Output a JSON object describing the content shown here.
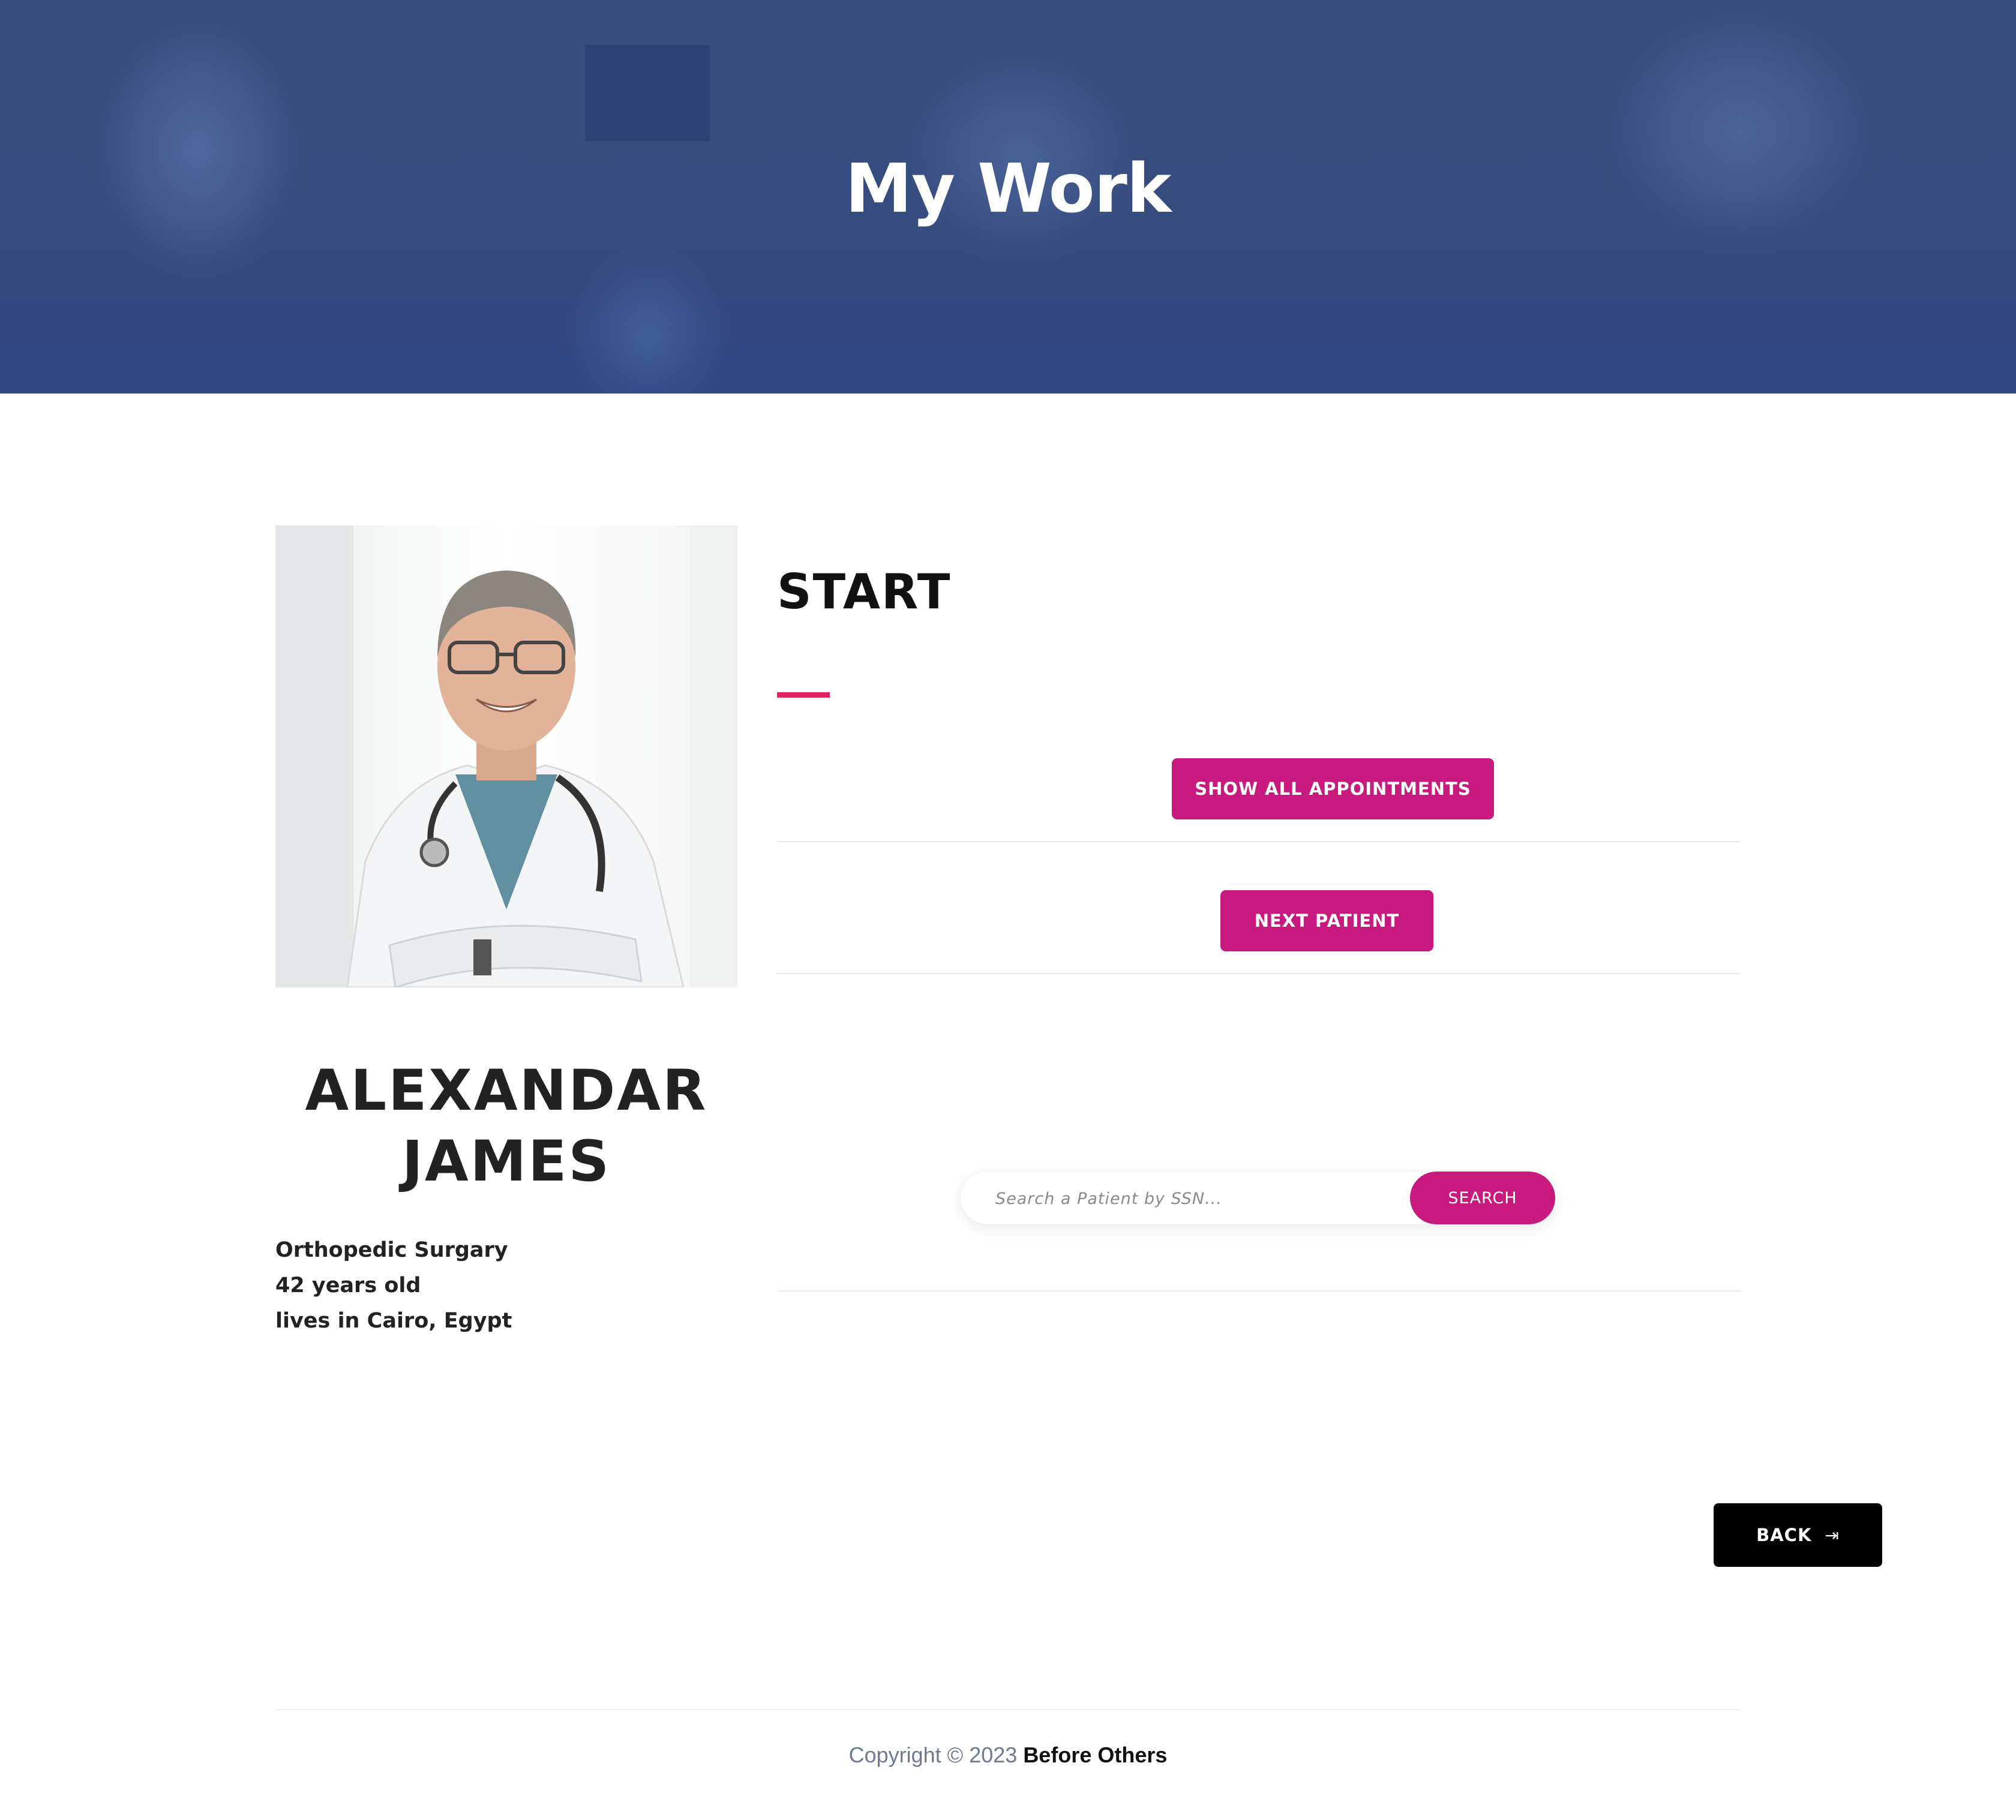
{
  "hero": {
    "title": "My Work"
  },
  "doctor": {
    "name_line1": "ALEXANDAR",
    "name_line2": "JAMES",
    "specialty": "Orthopedic Surgary",
    "age": "42 years old",
    "location": "lives in Cairo, Egypt"
  },
  "main": {
    "start_title": "START",
    "show_all_appointments_label": "SHOW ALL APPOINTMENTS",
    "next_patient_label": "NEXT PATIENT"
  },
  "search": {
    "placeholder": "Search a Patient by SSN...",
    "button_label": "SEARCH"
  },
  "back": {
    "label": "BACK",
    "icon": "exit-arrow-icon"
  },
  "footer": {
    "prefix": "Copyright © 2023",
    "brand": "Before Others"
  },
  "colors": {
    "accent": "#c8197f",
    "underline": "#e0245e",
    "hero": "#364b7e"
  }
}
